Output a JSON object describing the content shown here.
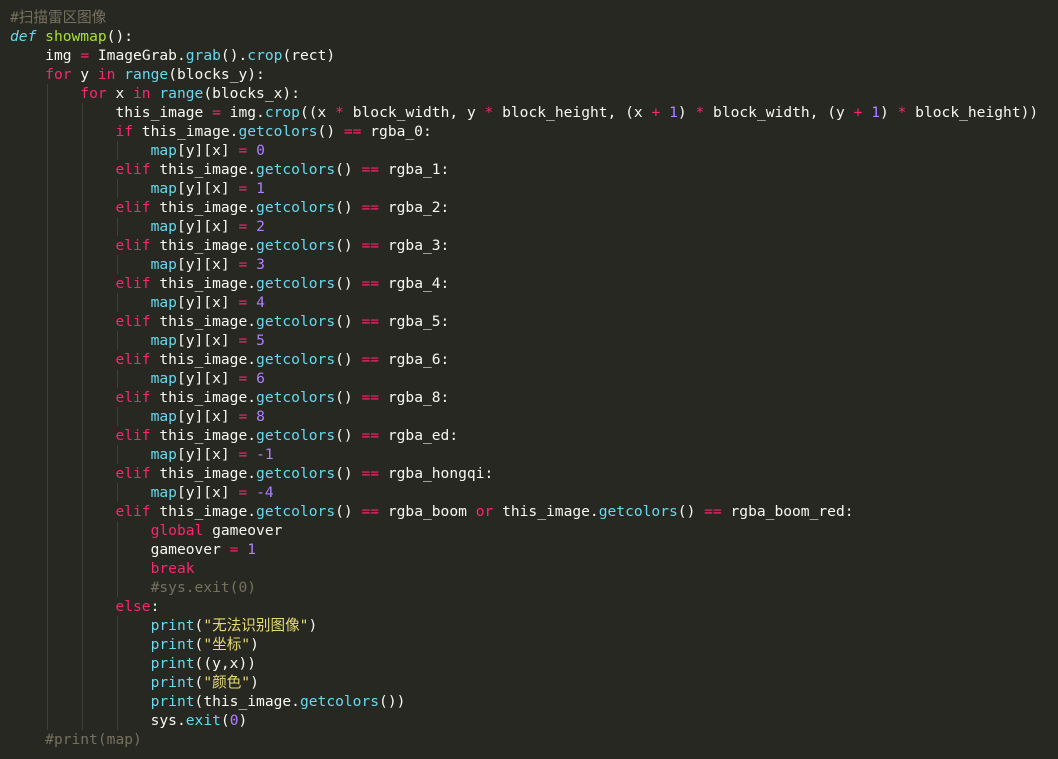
{
  "editor": {
    "theme": "monokai",
    "colors": {
      "background": "#272822",
      "text": "#F8F8F2",
      "keyword": "#F92672",
      "function_name": "#A6E22E",
      "builtin": "#66D9EF",
      "number": "#AE81FF",
      "string": "#E6DB74",
      "comment": "#75715E"
    },
    "lines": [
      {
        "indent": 0,
        "tokens": [
          [
            "cm",
            "#扫描雷区图像"
          ]
        ]
      },
      {
        "indent": 0,
        "tokens": [
          [
            "def",
            "def"
          ],
          [
            "txt",
            " "
          ],
          [
            "fn",
            "showmap"
          ],
          [
            "txt",
            "():"
          ]
        ]
      },
      {
        "indent": 1,
        "tokens": [
          [
            "txt",
            "img "
          ],
          [
            "op",
            "="
          ],
          [
            "txt",
            " ImageGrab."
          ],
          [
            "builtin",
            "grab"
          ],
          [
            "txt",
            "()."
          ],
          [
            "builtin",
            "crop"
          ],
          [
            "txt",
            "(rect)"
          ]
        ]
      },
      {
        "indent": 1,
        "tokens": [
          [
            "kw",
            "for"
          ],
          [
            "txt",
            " y "
          ],
          [
            "kw",
            "in"
          ],
          [
            "txt",
            " "
          ],
          [
            "builtin",
            "range"
          ],
          [
            "txt",
            "(blocks_y):"
          ]
        ]
      },
      {
        "indent": 2,
        "tokens": [
          [
            "kw",
            "for"
          ],
          [
            "txt",
            " x "
          ],
          [
            "kw",
            "in"
          ],
          [
            "txt",
            " "
          ],
          [
            "builtin",
            "range"
          ],
          [
            "txt",
            "(blocks_x):"
          ]
        ]
      },
      {
        "indent": 3,
        "tokens": [
          [
            "txt",
            "this_image "
          ],
          [
            "op",
            "="
          ],
          [
            "txt",
            " img."
          ],
          [
            "builtin",
            "crop"
          ],
          [
            "txt",
            "((x "
          ],
          [
            "op",
            "*"
          ],
          [
            "txt",
            " block_width, y "
          ],
          [
            "op",
            "*"
          ],
          [
            "txt",
            " block_height, (x "
          ],
          [
            "op",
            "+"
          ],
          [
            "txt",
            " "
          ],
          [
            "num",
            "1"
          ],
          [
            "txt",
            ") "
          ],
          [
            "op",
            "*"
          ],
          [
            "txt",
            " block_width, (y "
          ],
          [
            "op",
            "+"
          ],
          [
            "txt",
            " "
          ],
          [
            "num",
            "1"
          ],
          [
            "txt",
            ") "
          ],
          [
            "op",
            "*"
          ],
          [
            "txt",
            " block_height))"
          ]
        ]
      },
      {
        "indent": 3,
        "tokens": [
          [
            "kw",
            "if"
          ],
          [
            "txt",
            " this_image."
          ],
          [
            "builtin",
            "getcolors"
          ],
          [
            "txt",
            "() "
          ],
          [
            "op",
            "=="
          ],
          [
            "txt",
            " rgba_0:"
          ]
        ]
      },
      {
        "indent": 4,
        "tokens": [
          [
            "builtin",
            "map"
          ],
          [
            "txt",
            "[y][x] "
          ],
          [
            "op",
            "="
          ],
          [
            "txt",
            " "
          ],
          [
            "num",
            "0"
          ]
        ]
      },
      {
        "indent": 3,
        "tokens": [
          [
            "kw",
            "elif"
          ],
          [
            "txt",
            " this_image."
          ],
          [
            "builtin",
            "getcolors"
          ],
          [
            "txt",
            "() "
          ],
          [
            "op",
            "=="
          ],
          [
            "txt",
            " rgba_1:"
          ]
        ]
      },
      {
        "indent": 4,
        "tokens": [
          [
            "builtin",
            "map"
          ],
          [
            "txt",
            "[y][x] "
          ],
          [
            "op",
            "="
          ],
          [
            "txt",
            " "
          ],
          [
            "num",
            "1"
          ]
        ]
      },
      {
        "indent": 3,
        "tokens": [
          [
            "kw",
            "elif"
          ],
          [
            "txt",
            " this_image."
          ],
          [
            "builtin",
            "getcolors"
          ],
          [
            "txt",
            "() "
          ],
          [
            "op",
            "=="
          ],
          [
            "txt",
            " rgba_2:"
          ]
        ]
      },
      {
        "indent": 4,
        "tokens": [
          [
            "builtin",
            "map"
          ],
          [
            "txt",
            "[y][x] "
          ],
          [
            "op",
            "="
          ],
          [
            "txt",
            " "
          ],
          [
            "num",
            "2"
          ]
        ]
      },
      {
        "indent": 3,
        "tokens": [
          [
            "kw",
            "elif"
          ],
          [
            "txt",
            " this_image."
          ],
          [
            "builtin",
            "getcolors"
          ],
          [
            "txt",
            "() "
          ],
          [
            "op",
            "=="
          ],
          [
            "txt",
            " rgba_3:"
          ]
        ]
      },
      {
        "indent": 4,
        "tokens": [
          [
            "builtin",
            "map"
          ],
          [
            "txt",
            "[y][x] "
          ],
          [
            "op",
            "="
          ],
          [
            "txt",
            " "
          ],
          [
            "num",
            "3"
          ]
        ]
      },
      {
        "indent": 3,
        "tokens": [
          [
            "kw",
            "elif"
          ],
          [
            "txt",
            " this_image."
          ],
          [
            "builtin",
            "getcolors"
          ],
          [
            "txt",
            "() "
          ],
          [
            "op",
            "=="
          ],
          [
            "txt",
            " rgba_4:"
          ]
        ]
      },
      {
        "indent": 4,
        "tokens": [
          [
            "builtin",
            "map"
          ],
          [
            "txt",
            "[y][x] "
          ],
          [
            "op",
            "="
          ],
          [
            "txt",
            " "
          ],
          [
            "num",
            "4"
          ]
        ]
      },
      {
        "indent": 3,
        "tokens": [
          [
            "kw",
            "elif"
          ],
          [
            "txt",
            " this_image."
          ],
          [
            "builtin",
            "getcolors"
          ],
          [
            "txt",
            "() "
          ],
          [
            "op",
            "=="
          ],
          [
            "txt",
            " rgba_5:"
          ]
        ]
      },
      {
        "indent": 4,
        "tokens": [
          [
            "builtin",
            "map"
          ],
          [
            "txt",
            "[y][x] "
          ],
          [
            "op",
            "="
          ],
          [
            "txt",
            " "
          ],
          [
            "num",
            "5"
          ]
        ]
      },
      {
        "indent": 3,
        "tokens": [
          [
            "kw",
            "elif"
          ],
          [
            "txt",
            " this_image."
          ],
          [
            "builtin",
            "getcolors"
          ],
          [
            "txt",
            "() "
          ],
          [
            "op",
            "=="
          ],
          [
            "txt",
            " rgba_6:"
          ]
        ]
      },
      {
        "indent": 4,
        "tokens": [
          [
            "builtin",
            "map"
          ],
          [
            "txt",
            "[y][x] "
          ],
          [
            "op",
            "="
          ],
          [
            "txt",
            " "
          ],
          [
            "num",
            "6"
          ]
        ]
      },
      {
        "indent": 3,
        "tokens": [
          [
            "kw",
            "elif"
          ],
          [
            "txt",
            " this_image."
          ],
          [
            "builtin",
            "getcolors"
          ],
          [
            "txt",
            "() "
          ],
          [
            "op",
            "=="
          ],
          [
            "txt",
            " rgba_8:"
          ]
        ]
      },
      {
        "indent": 4,
        "tokens": [
          [
            "builtin",
            "map"
          ],
          [
            "txt",
            "[y][x] "
          ],
          [
            "op",
            "="
          ],
          [
            "txt",
            " "
          ],
          [
            "num",
            "8"
          ]
        ]
      },
      {
        "indent": 3,
        "tokens": [
          [
            "kw",
            "elif"
          ],
          [
            "txt",
            " this_image."
          ],
          [
            "builtin",
            "getcolors"
          ],
          [
            "txt",
            "() "
          ],
          [
            "op",
            "=="
          ],
          [
            "txt",
            " rgba_ed:"
          ]
        ]
      },
      {
        "indent": 4,
        "tokens": [
          [
            "builtin",
            "map"
          ],
          [
            "txt",
            "[y][x] "
          ],
          [
            "op",
            "="
          ],
          [
            "txt",
            " "
          ],
          [
            "num",
            "-1"
          ]
        ]
      },
      {
        "indent": 3,
        "tokens": [
          [
            "kw",
            "elif"
          ],
          [
            "txt",
            " this_image."
          ],
          [
            "builtin",
            "getcolors"
          ],
          [
            "txt",
            "() "
          ],
          [
            "op",
            "=="
          ],
          [
            "txt",
            " rgba_hongqi:"
          ]
        ]
      },
      {
        "indent": 4,
        "tokens": [
          [
            "builtin",
            "map"
          ],
          [
            "txt",
            "[y][x] "
          ],
          [
            "op",
            "="
          ],
          [
            "txt",
            " "
          ],
          [
            "num",
            "-4"
          ]
        ]
      },
      {
        "indent": 3,
        "tokens": [
          [
            "kw",
            "elif"
          ],
          [
            "txt",
            " this_image."
          ],
          [
            "builtin",
            "getcolors"
          ],
          [
            "txt",
            "() "
          ],
          [
            "op",
            "=="
          ],
          [
            "txt",
            " rgba_boom "
          ],
          [
            "kw",
            "or"
          ],
          [
            "txt",
            " this_image."
          ],
          [
            "builtin",
            "getcolors"
          ],
          [
            "txt",
            "() "
          ],
          [
            "op",
            "=="
          ],
          [
            "txt",
            " rgba_boom_red:"
          ]
        ]
      },
      {
        "indent": 4,
        "tokens": [
          [
            "kw",
            "global"
          ],
          [
            "txt",
            " gameover"
          ]
        ]
      },
      {
        "indent": 4,
        "tokens": [
          [
            "txt",
            "gameover "
          ],
          [
            "op",
            "="
          ],
          [
            "txt",
            " "
          ],
          [
            "num",
            "1"
          ]
        ]
      },
      {
        "indent": 4,
        "tokens": [
          [
            "kw",
            "break"
          ]
        ]
      },
      {
        "indent": 4,
        "tokens": [
          [
            "cm",
            "#sys.exit(0)"
          ]
        ]
      },
      {
        "indent": 3,
        "tokens": [
          [
            "kw",
            "else"
          ],
          [
            "txt",
            ":"
          ]
        ]
      },
      {
        "indent": 4,
        "tokens": [
          [
            "builtin",
            "print"
          ],
          [
            "txt",
            "("
          ],
          [
            "str",
            "\"无法识别图像\""
          ],
          [
            "txt",
            ")"
          ]
        ]
      },
      {
        "indent": 4,
        "tokens": [
          [
            "builtin",
            "print"
          ],
          [
            "txt",
            "("
          ],
          [
            "str",
            "\"坐标\""
          ],
          [
            "txt",
            ")"
          ]
        ]
      },
      {
        "indent": 4,
        "tokens": [
          [
            "builtin",
            "print"
          ],
          [
            "txt",
            "((y,x))"
          ]
        ]
      },
      {
        "indent": 4,
        "tokens": [
          [
            "builtin",
            "print"
          ],
          [
            "txt",
            "("
          ],
          [
            "str",
            "\"颜色\""
          ],
          [
            "txt",
            ")"
          ]
        ]
      },
      {
        "indent": 4,
        "tokens": [
          [
            "builtin",
            "print"
          ],
          [
            "txt",
            "(this_image."
          ],
          [
            "builtin",
            "getcolors"
          ],
          [
            "txt",
            "())"
          ]
        ]
      },
      {
        "indent": 4,
        "tokens": [
          [
            "txt",
            "sys."
          ],
          [
            "builtin",
            "exit"
          ],
          [
            "txt",
            "("
          ],
          [
            "num",
            "0"
          ],
          [
            "txt",
            ")"
          ]
        ]
      },
      {
        "indent": 1,
        "tokens": [
          [
            "cm",
            "#print(map)"
          ]
        ]
      }
    ]
  }
}
